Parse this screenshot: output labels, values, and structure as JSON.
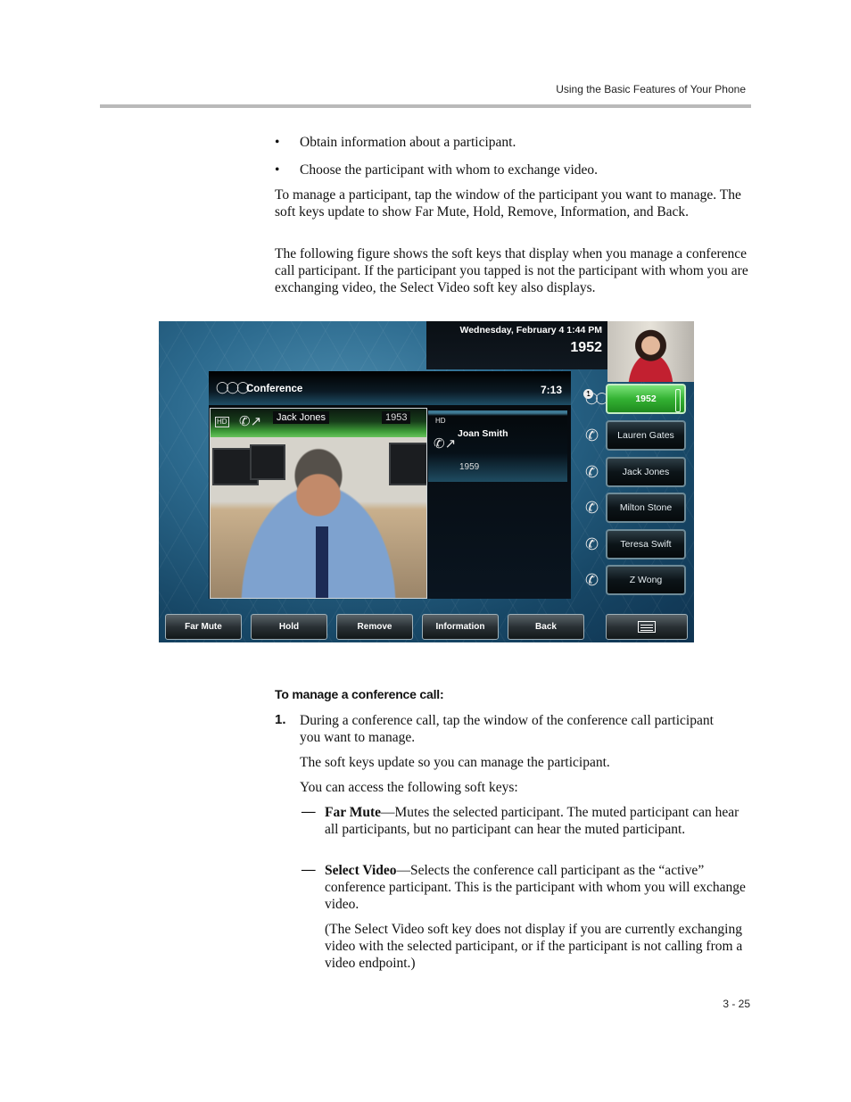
{
  "page_header": "Using the Basic Features of Your Phone",
  "bullets": [
    "Obtain information about a participant.",
    "Choose the participant with whom to exchange video."
  ],
  "paragraphs": [
    "To manage a participant, tap the window of the participant you want to manage. The soft keys update to show Far Mute, Hold, Remove, Information, and Back.",
    "The following figure shows the soft keys that display when you manage a conference call participant. If the participant you tapped is not the participant with whom you are exchanging video, the Select Video soft key also displays."
  ],
  "phone": {
    "datetime": "Wednesday, February 4  1:44 PM",
    "extension": "1952",
    "conference_title": "Conference",
    "conference_timer": "7:13",
    "participants": [
      {
        "name": "Jack Jones",
        "number": "1953",
        "hd": "HD",
        "selected": true
      },
      {
        "name": "Joan Smith",
        "number": "1959",
        "hd": "HD",
        "selected": false
      }
    ],
    "line_badge": "1",
    "line_keys": [
      {
        "label": "1952",
        "active": true
      },
      {
        "label": "Lauren Gates"
      },
      {
        "label": "Jack Jones"
      },
      {
        "label": "Milton Stone"
      },
      {
        "label": "Teresa Swift"
      },
      {
        "label": "Z Wong"
      }
    ],
    "soft_keys": [
      "Far Mute",
      "Hold",
      "Remove",
      "Information",
      "Back"
    ],
    "menu_icon": "menu-icon"
  },
  "procedure": {
    "title": "To manage a conference call:",
    "step_number": "1.",
    "step_text": "During a conference call, tap the window of the conference call participant you want to manage.",
    "sub1": "The soft keys update so you can manage the participant.",
    "sub2": "You can access the following soft keys:",
    "items": [
      {
        "dash": "—",
        "term": "Far Mute",
        "desc": "—Mutes the selected participant. The muted participant can hear all participants, but no participant can hear the muted participant."
      },
      {
        "dash": "—",
        "term": "Select Video",
        "desc": "—Selects the conference call participant as the “active” conference participant. This is the participant with whom you will exchange video."
      }
    ],
    "note": "(The Select Video soft key does not display if you are currently exchanging video with the selected participant, or if the participant is not calling from a video endpoint.)"
  },
  "page_number": "3 - 25"
}
